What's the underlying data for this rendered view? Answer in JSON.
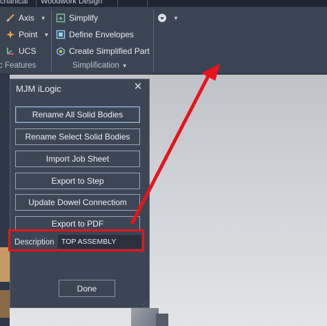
{
  "tabs": [
    {
      "label": "chanical"
    },
    {
      "label": "Woodwork Design"
    }
  ],
  "ribbon": {
    "group1": {
      "items": [
        {
          "label": "Axis",
          "icon": "axis-icon"
        },
        {
          "label": "Point",
          "icon": "point-icon"
        },
        {
          "label": "UCS",
          "icon": "ucs-icon"
        }
      ],
      "label": "c Features"
    },
    "group2": {
      "items": [
        {
          "label": "Simplify",
          "icon": "simplify-icon"
        },
        {
          "label": "Define Envelopes",
          "icon": "define-envelopes-icon"
        },
        {
          "label": "Create Simplified Part",
          "icon": "create-simplified-part-icon"
        }
      ],
      "label": "Simplification"
    },
    "group3": {
      "icon": "qat-menu-icon"
    }
  },
  "dialog": {
    "title": "MJM iLogic",
    "close_glyph": "✕",
    "buttons": [
      {
        "label": "Rename All Solid Bodies"
      },
      {
        "label": "Rename Select Solid Bodies"
      },
      {
        "label": "Import Job Sheet"
      },
      {
        "label": "Export to Step"
      },
      {
        "label": "Update Dowel Connectiom"
      },
      {
        "label": "Export to PDF"
      }
    ],
    "description_label": "Description",
    "description_value": "TOP ASSEMBLY",
    "done_label": "Done"
  },
  "colors": {
    "annotation_red": "#e8141a",
    "dialog_bg": "#3b4554",
    "ribbon_bg": "#3b4453"
  }
}
